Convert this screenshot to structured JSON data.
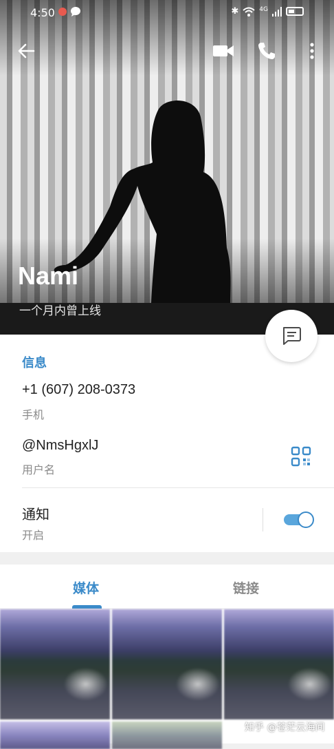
{
  "status_bar": {
    "time": "4:50",
    "network_type": "4G",
    "battery_level": 0.45
  },
  "header": {
    "name": "Nami",
    "last_seen": "一个月内曾上线"
  },
  "info": {
    "section_title": "信息",
    "phone": "+1 (607) 208-0373",
    "phone_label": "手机",
    "username": "@NmsHgxlJ",
    "username_label": "用户名",
    "notifications": "通知",
    "notifications_state": "开启",
    "notifications_enabled": true
  },
  "tabs": [
    {
      "label": "媒体",
      "active": true
    },
    {
      "label": "链接",
      "active": false
    }
  ],
  "watermark": "知乎 @苍茫云海间",
  "colors": {
    "accent": "#3a8ac9",
    "toggle_track": "#5aa6dc",
    "secondary_text": "#8a8a8a"
  },
  "icons": [
    "back-arrow-icon",
    "video-call-icon",
    "phone-icon",
    "more-vertical-icon",
    "message-icon",
    "qr-code-icon"
  ]
}
